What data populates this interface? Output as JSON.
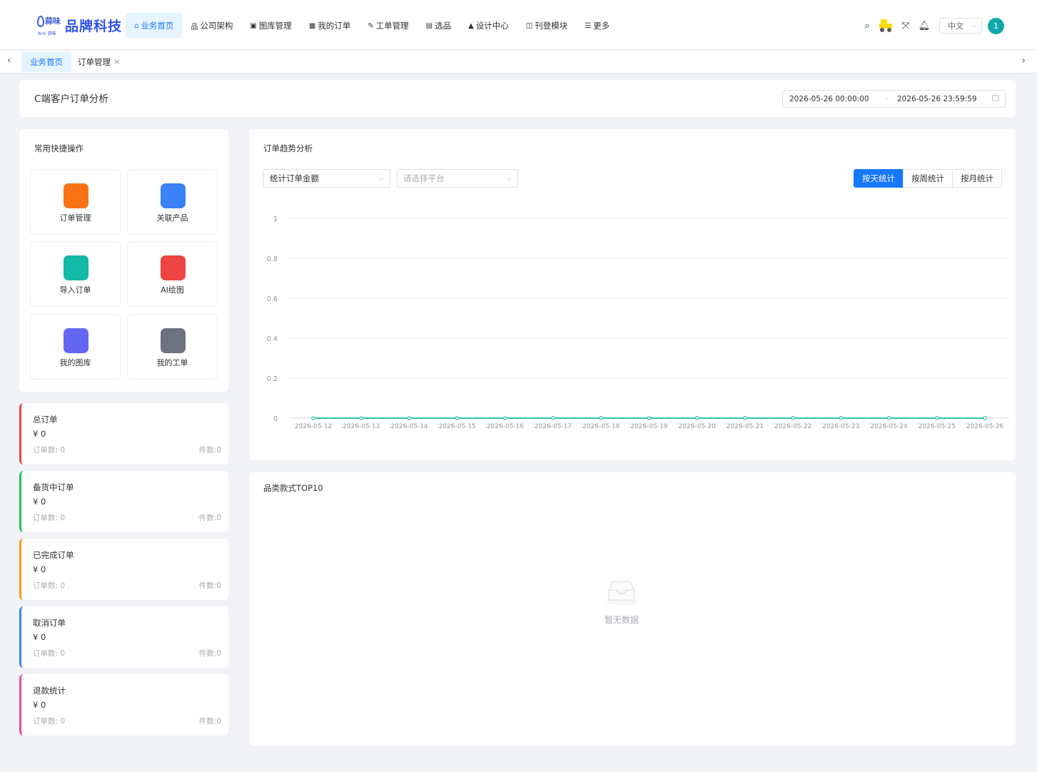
{
  "brand": {
    "logo_small": "蒜味",
    "logo_tiny": "Anti 蒜味",
    "name": "品牌科技"
  },
  "nav": [
    {
      "icon": "home-icon",
      "glyph": "⌂",
      "label": "业务首页",
      "active": true
    },
    {
      "icon": "org-icon",
      "glyph": "品",
      "label": "公司架构"
    },
    {
      "icon": "image-icon",
      "glyph": "▣",
      "label": "图库管理"
    },
    {
      "icon": "grid-icon",
      "glyph": "▦",
      "label": "我的订单"
    },
    {
      "icon": "edit-icon",
      "glyph": "✎",
      "label": "工单管理"
    },
    {
      "icon": "table-icon",
      "glyph": "▤",
      "label": "选品"
    },
    {
      "icon": "design-icon",
      "glyph": "▲",
      "label": "设计中心"
    },
    {
      "icon": "publish-icon",
      "glyph": "◫",
      "label": "刊登模块"
    },
    {
      "icon": "menu-icon",
      "glyph": "☰",
      "label": "更多"
    }
  ],
  "header": {
    "language": "中文",
    "avatar": "1"
  },
  "tabs": [
    {
      "label": "业务首页",
      "active": true
    },
    {
      "label": "订单管理",
      "closable": true
    }
  ],
  "page": {
    "title": "C端客户订单分析",
    "date_start": "2026-05-26 00:00:00",
    "date_sep": "–",
    "date_end": "2026-05-26 23:59:59"
  },
  "quick": {
    "title": "常用快捷操作",
    "items": [
      {
        "label": "订单管理",
        "color": "#f97316"
      },
      {
        "label": "关联产品",
        "color": "#3b82f6"
      },
      {
        "label": "导入订单",
        "color": "#14b8a6"
      },
      {
        "label": "AI绘图",
        "color": "#ef4444"
      },
      {
        "label": "我的图库",
        "color": "#6366f1"
      },
      {
        "label": "我的工单",
        "color": "#6b7280"
      }
    ]
  },
  "stats": [
    {
      "title": "总订单",
      "value": "¥ 0",
      "orders": "订单数: 0",
      "pieces": "件数:0",
      "color": "#ef4444"
    },
    {
      "title": "备货中订单",
      "value": "¥ 0",
      "orders": "订单数: 0",
      "pieces": "件数:0",
      "color": "#22c55e"
    },
    {
      "title": "已完成订单",
      "value": "¥ 0",
      "orders": "订单数: 0",
      "pieces": "件数:0",
      "color": "#f59e0b"
    },
    {
      "title": "取消订单",
      "value": "¥ 0",
      "orders": "订单数: 0",
      "pieces": "件数:0",
      "color": "#3b82f6"
    },
    {
      "title": "退款统计",
      "value": "¥ 0",
      "orders": "订单数: 0",
      "pieces": "件数:0",
      "color": "#ec4899"
    }
  ],
  "trend": {
    "title": "订单趋势分析",
    "metric_select": "统计订单金额",
    "platform_placeholder": "请选择平台",
    "buttons": [
      {
        "label": "按天统计",
        "active": true
      },
      {
        "label": "按周统计"
      },
      {
        "label": "按月统计"
      }
    ]
  },
  "chart_data": {
    "type": "line",
    "x": [
      "2026-05-12",
      "2026-05-13",
      "2026-05-14",
      "2026-05-15",
      "2026-05-16",
      "2026-05-17",
      "2026-05-18",
      "2026-05-19",
      "2026-05-20",
      "2026-05-21",
      "2026-05-22",
      "2026-05-23",
      "2026-05-24",
      "2026-05-25",
      "2026-05-26"
    ],
    "series": [
      {
        "values": [
          0,
          0,
          0,
          0,
          0,
          0,
          0,
          0,
          0,
          0,
          0,
          0,
          0,
          0,
          0
        ],
        "color": "#2ec7a4"
      }
    ],
    "yticks": [
      "0",
      "0.2",
      "0.4",
      "0.6",
      "0.8",
      "1"
    ],
    "ylim": [
      0,
      1
    ],
    "grid": true
  },
  "top10": {
    "title": "品类款式TOP10",
    "empty_text": "暂无数据"
  },
  "colors": {
    "primary": "#1677ff",
    "line": "#2ec7a4"
  }
}
